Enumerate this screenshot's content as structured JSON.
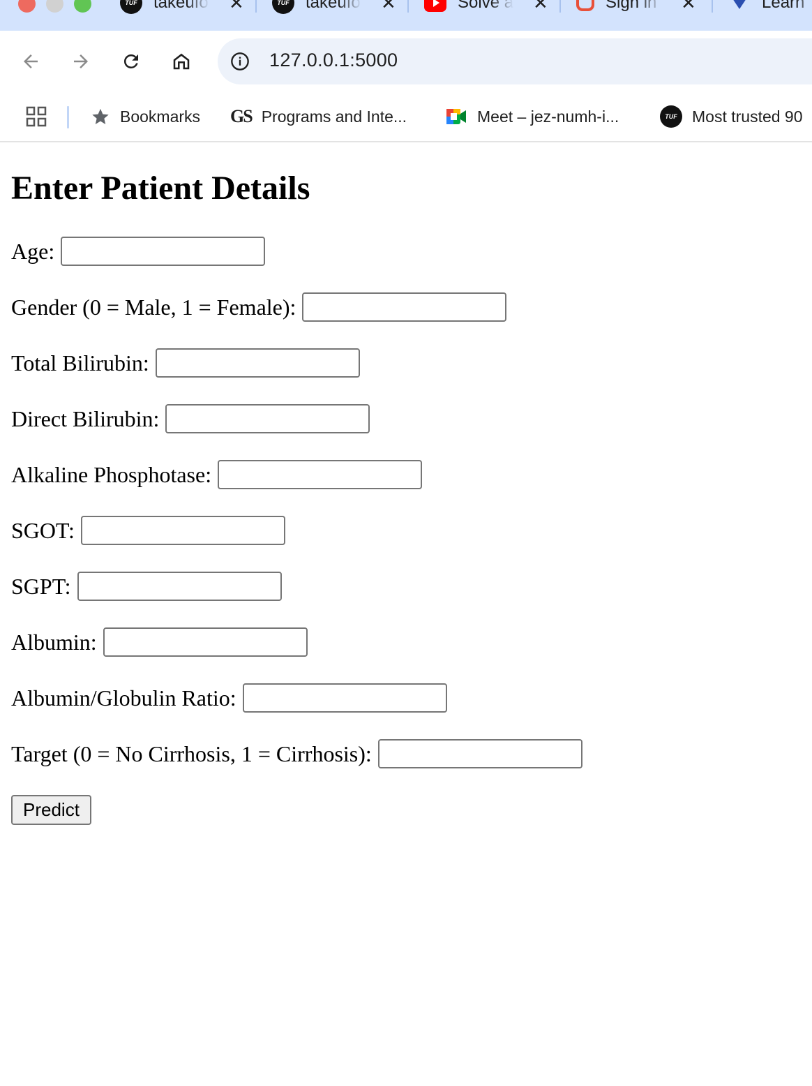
{
  "browser": {
    "tabs": [
      {
        "title": "takeuforward",
        "icon": "tuf-favicon"
      },
      {
        "title": "takeuforward",
        "icon": "tuf-favicon"
      },
      {
        "title": "Solve a",
        "icon": "youtube-favicon"
      },
      {
        "title": "Sign in",
        "icon": "signin-favicon"
      },
      {
        "title": "Learn",
        "icon": "learn-favicon"
      }
    ],
    "tab_favicon_text": "TUF",
    "close_glyph": "✕",
    "url": "127.0.0.1:5000",
    "bookmarks": [
      {
        "label": "Bookmarks",
        "icon": "star-icon"
      },
      {
        "label": "Programs and Inte...",
        "icon": "gs-logo",
        "logo_text": "GS"
      },
      {
        "label": "Meet – jez-numh-i...",
        "icon": "google-meet-icon"
      },
      {
        "label": "Most trusted 90",
        "icon": "tuf-favicon",
        "logo_text": "TUF"
      }
    ]
  },
  "form": {
    "heading": "Enter Patient Details",
    "fields": [
      {
        "label": "Age:",
        "value": ""
      },
      {
        "label": "Gender (0 = Male, 1 = Female):",
        "value": ""
      },
      {
        "label": "Total Bilirubin:",
        "value": ""
      },
      {
        "label": "Direct Bilirubin:",
        "value": ""
      },
      {
        "label": "Alkaline Phosphotase:",
        "value": ""
      },
      {
        "label": "SGOT:",
        "value": ""
      },
      {
        "label": "SGPT:",
        "value": ""
      },
      {
        "label": "Albumin:",
        "value": ""
      },
      {
        "label": "Albumin/Globulin Ratio:",
        "value": ""
      },
      {
        "label": "Target (0 = No Cirrhosis, 1 = Cirrhosis):",
        "value": ""
      }
    ],
    "submit_label": "Predict"
  }
}
